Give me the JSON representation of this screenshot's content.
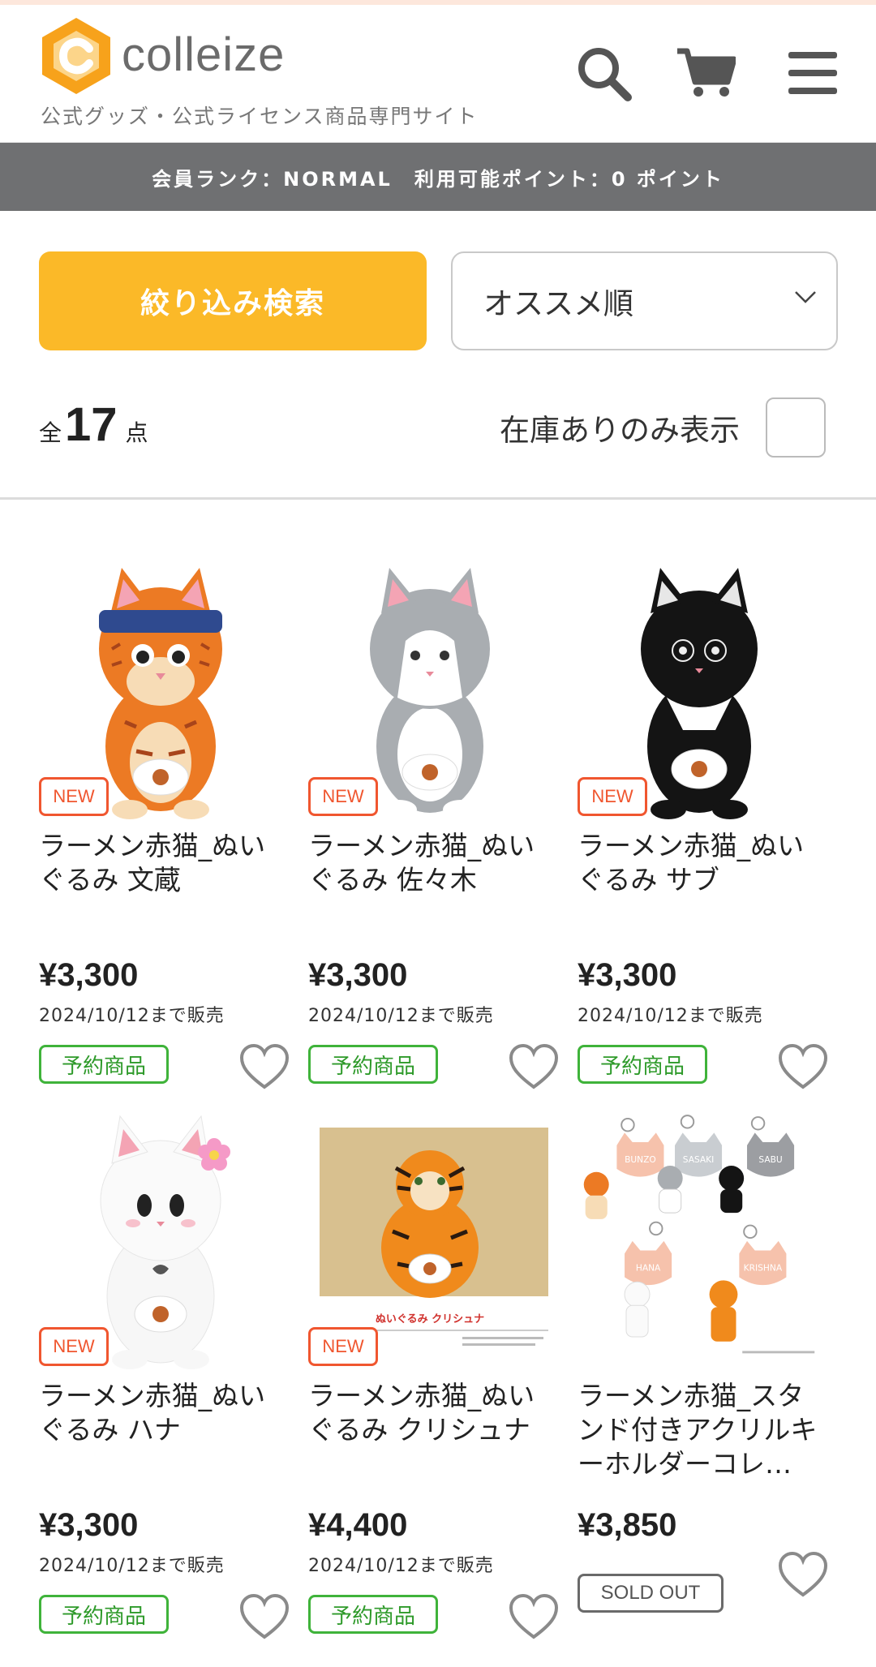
{
  "header": {
    "brand": "colleize",
    "tagline": "公式グッズ・公式ライセンス商品専門サイト",
    "logo_color": "#f7a21b",
    "icons": [
      "search-icon",
      "cart-icon",
      "menu-icon"
    ]
  },
  "member_bar": {
    "text": "会員ランク：NORMAL　利用可能ポイント：0 ポイント"
  },
  "controls": {
    "filter_label": "絞り込み検索",
    "sort_value": "オススメ順",
    "count_prefix": "全",
    "count_value": "17",
    "count_suffix": "点",
    "stock_label": "在庫ありのみ表示"
  },
  "colors": {
    "accent": "#fbb928",
    "new_badge": "#f0562f",
    "preorder_badge": "#3fb33a",
    "member_bar_bg": "#6f7072"
  },
  "products": [
    {
      "name": "ラーメン赤猫_ぬいぐるみ 文蔵",
      "price": "¥3,300",
      "date": "2024/10/12まで販売",
      "badge": "NEW",
      "status": "予約商品"
    },
    {
      "name": "ラーメン赤猫_ぬいぐるみ 佐々木",
      "price": "¥3,300",
      "date": "2024/10/12まで販売",
      "badge": "NEW",
      "status": "予約商品"
    },
    {
      "name": "ラーメン赤猫_ぬいぐるみ サブ",
      "price": "¥3,300",
      "date": "2024/10/12まで販売",
      "badge": "NEW",
      "status": "予約商品"
    },
    {
      "name": "ラーメン赤猫_ぬいぐるみ ハナ",
      "price": "¥3,300",
      "date": "2024/10/12まで販売",
      "badge": "NEW",
      "status": "予約商品"
    },
    {
      "name": "ラーメン赤猫_ぬいぐるみ クリシュナ",
      "price": "¥4,400",
      "date": "2024/10/12まで販売",
      "badge": "NEW",
      "status": "予約商品",
      "image_caption": "ぬいぐるみ クリシュナ"
    },
    {
      "name": "ラーメン赤猫_スタンド付きアクリルキーホルダーコレ…",
      "price": "¥3,850",
      "status": "SOLD OUT",
      "image_labels": [
        "BUNZO",
        "SASAKI",
        "SABU",
        "HANA",
        "KRISHNA"
      ]
    }
  ]
}
